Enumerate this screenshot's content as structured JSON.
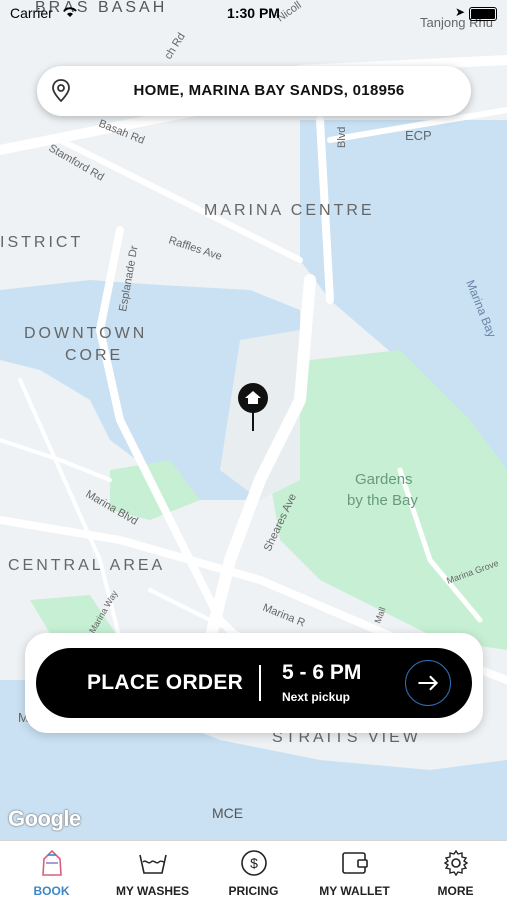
{
  "status_bar": {
    "carrier": "Carrier",
    "time": "1:30 PM"
  },
  "address": {
    "label": "HOME, MARINA BAY SANDS, 018956"
  },
  "map": {
    "attribution": "Google",
    "labels": {
      "bras_basah": "BRAS BASAH",
      "basah_rd": "Basah Rd",
      "stamford_rd": "Stamford Rd",
      "bras_rd": "ch Rd",
      "nicoll": "Nicoll",
      "blvd": "Blvd",
      "ecp": "ECP",
      "tanjong_rhu": "Tanjong Rhu",
      "marina_centre": "MARINA CENTRE",
      "district": "ISTRICT",
      "esplanade_dr": "Esplanade Dr",
      "raffles_ave": "Raffles Ave",
      "marina_bay": "Marina Bay",
      "downtown_1": "DOWNTOWN",
      "downtown_2": "CORE",
      "gardens_1": "Gardens",
      "gardens_2": "by the Bay",
      "marina_blvd": "Marina Blvd",
      "sheares_ave": "Sheares Ave",
      "central_area": "CENTRAL AREA",
      "marina_way": "Marina Way",
      "marina_grove": "Marina Grove",
      "marina_r": "Marina R",
      "mall": "Mall",
      "straits_view": "STRAITS VIEW",
      "mce": "MCE",
      "m_partial": "M"
    }
  },
  "order": {
    "label": "PLACE ORDER",
    "slot": "5 - 6 PM",
    "sub": "Next pickup"
  },
  "tabs": [
    {
      "label": "BOOK",
      "icon": "book-icon",
      "active": true
    },
    {
      "label": "MY WASHES",
      "icon": "wash-icon",
      "active": false
    },
    {
      "label": "PRICING",
      "icon": "pricing-icon",
      "active": false
    },
    {
      "label": "MY WALLET",
      "icon": "wallet-icon",
      "active": false
    },
    {
      "label": "MORE",
      "icon": "gear-icon",
      "active": false
    }
  ],
  "colors": {
    "map_land": "#eef2f4",
    "map_water": "#c9e1f3",
    "map_park": "#c7efd4",
    "active_tab": "#3d87c6",
    "button": "#000000"
  }
}
